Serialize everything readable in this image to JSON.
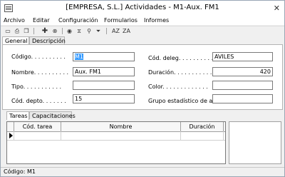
{
  "window": {
    "title": "[EMPRESA, S.L.] Actividades - M1-Aux. FM1",
    "close_glyph": "✕"
  },
  "menu": [
    "Archivo",
    "Editar",
    "Configuración",
    "Formularios",
    "Informes"
  ],
  "toolbar": {
    "icons": [
      "new-document-icon",
      "print-icon",
      "copy-icon",
      "add-icon",
      "delete-icon",
      "view-icon",
      "filter-icon",
      "search-icon",
      "funnel-icon",
      "sort-ascending-icon",
      "sort-descending-icon"
    ],
    "sort_asc": "AZ",
    "sort_desc": "ZA"
  },
  "tabs": [
    {
      "label": "General",
      "active": true
    },
    {
      "label": "Descripción",
      "active": false
    }
  ],
  "form": {
    "codigo": {
      "label": "Código. . . . . . . . . .",
      "value": "M1"
    },
    "nombre": {
      "label": "Nombre. . . . . . . . . .",
      "value": "Aux. FM1"
    },
    "tipo": {
      "label": "Tipo. . . . . . . . . . .",
      "value": ""
    },
    "cod_depto": {
      "label": "Cód. depto. . . . . . .",
      "value": "15"
    },
    "cod_deleg": {
      "label": "Cód. deleg. . . . . . . . . .",
      "value": "AVILES"
    },
    "duracion": {
      "label": "Duración. . . . . . . . . . .",
      "value": "420"
    },
    "color": {
      "label": "Color. . . . . . . . . . . . .",
      "value": ""
    },
    "grupo": {
      "label": "Grupo estadístico de acti",
      "value": ""
    }
  },
  "bottom_tabs": [
    {
      "label": "Tareas",
      "active": true
    },
    {
      "label": "Capacitaciones",
      "active": false
    }
  ],
  "grid": {
    "columns": [
      "Cód. tarea",
      "Nombre",
      "Duración"
    ],
    "rows": [
      [
        "",
        "",
        ""
      ]
    ]
  },
  "status": {
    "text": "Código: M1"
  }
}
